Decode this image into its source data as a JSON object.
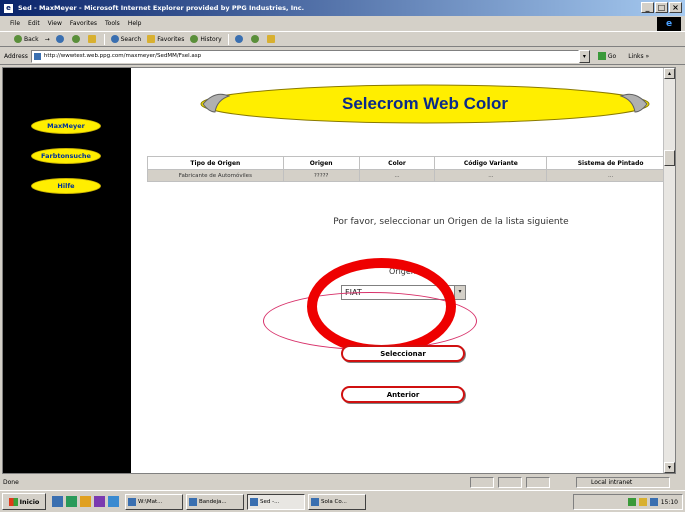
{
  "window": {
    "title": "Sed - MaxMeyer - Microsoft Internet Explorer provided by PPG Industries, Inc.",
    "buttons": [
      "_",
      "□",
      "×"
    ]
  },
  "menu": [
    "File",
    "Edit",
    "View",
    "Favorites",
    "Tools",
    "Help"
  ],
  "toolbar": {
    "back": "Back",
    "forward": "→",
    "search": "Search",
    "favorites": "Favorites",
    "history": "History"
  },
  "address": {
    "label": "Address",
    "url": "http://wwwtest.web.ppg.com/maxmeyer/SedMM/Fsel.asp",
    "go": "Go",
    "links": "Links »"
  },
  "nav": {
    "items": [
      "MaxMeyer",
      "Farbtonsuche",
      "Hilfe"
    ]
  },
  "banner": {
    "title": "Selecrom Web Color"
  },
  "table": {
    "headers": [
      "Tipo de Origen",
      "Origen",
      "Color",
      "Código Variante",
      "Sistema de Pintado"
    ],
    "rows": [
      [
        "Fabricante de Automóviles",
        "?????",
        "...",
        "...",
        "..."
      ]
    ]
  },
  "instruction": "Por favor, seleccionar un Origen de la lista siguiente",
  "form": {
    "origen_label": "Origen",
    "origen_value": "FIAT",
    "select_button": "Seleccionar",
    "prev_button": "Anterior"
  },
  "status": {
    "left": "Done",
    "zone": "Local intranet"
  },
  "taskbar": {
    "start": "Inicio",
    "tasks": [
      "W:\\Mat...",
      "Bandeja...",
      "Sed -...",
      "Sola Co..."
    ],
    "clock": "15:10"
  },
  "colors": {
    "nav_pill": "#ffee00",
    "banner_text": "#0a2a8a",
    "annotation_red": "#ee0000",
    "annotation_pink": "#d8336b",
    "button_border": "#d01010"
  }
}
